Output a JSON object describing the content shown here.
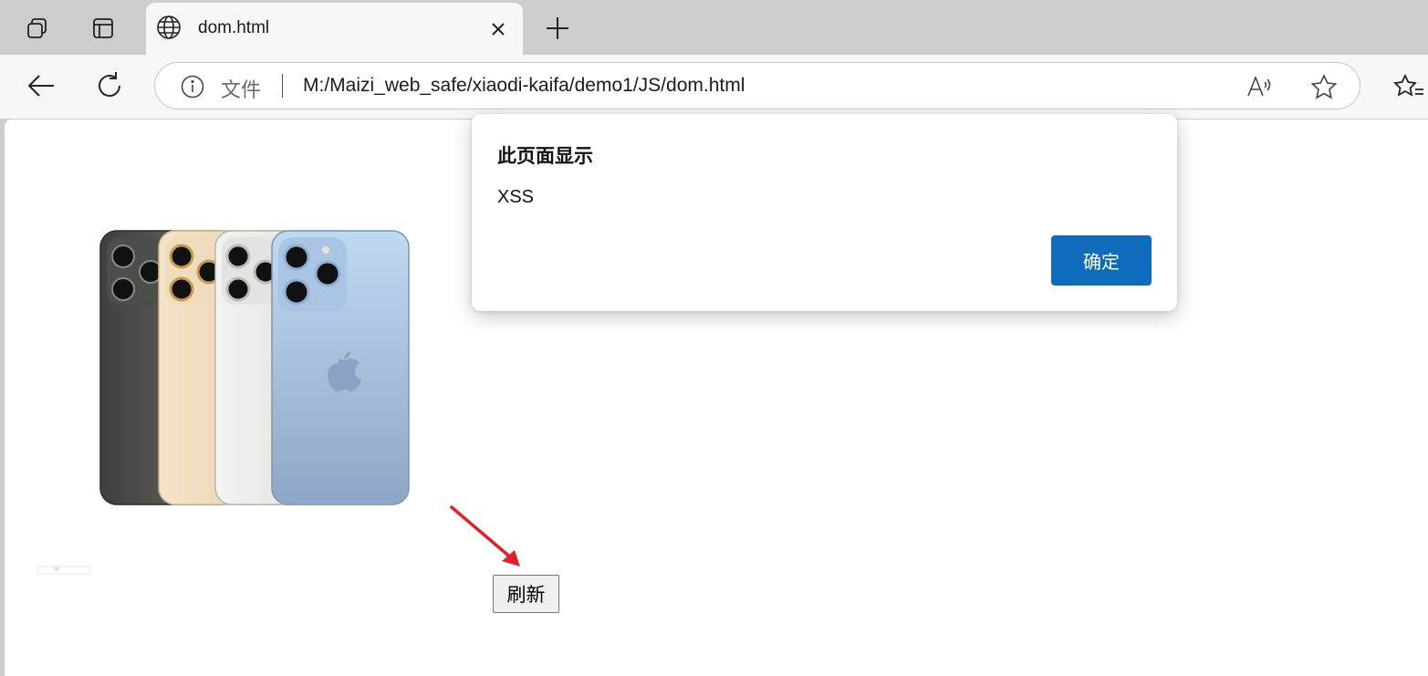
{
  "browser": {
    "tab": {
      "title": "dom.html",
      "close_glyph": "×"
    },
    "newtab_glyph": "+",
    "address_bar": {
      "site_label": "文件",
      "url": "M:/Maizi_web_safe/xiaodi-kaifa/demo1/JS/dom.html"
    },
    "icons": {
      "workspaces": "workspaces-icon",
      "tab_actions": "tab-actions-icon",
      "back": "back-arrow-icon",
      "reload": "reload-icon",
      "info": "info-icon",
      "read_aloud": "read-aloud-icon",
      "favorite": "star-icon",
      "favorites": "favorites-icon"
    }
  },
  "page": {
    "image": "iphone-product-image",
    "refresh_button": "刷新"
  },
  "dialog": {
    "title": "此页面显示",
    "message": "XSS",
    "ok_button": "确定"
  },
  "colors": {
    "accent": "#0f6cbd",
    "annotation_arrow": "#e0202a"
  }
}
